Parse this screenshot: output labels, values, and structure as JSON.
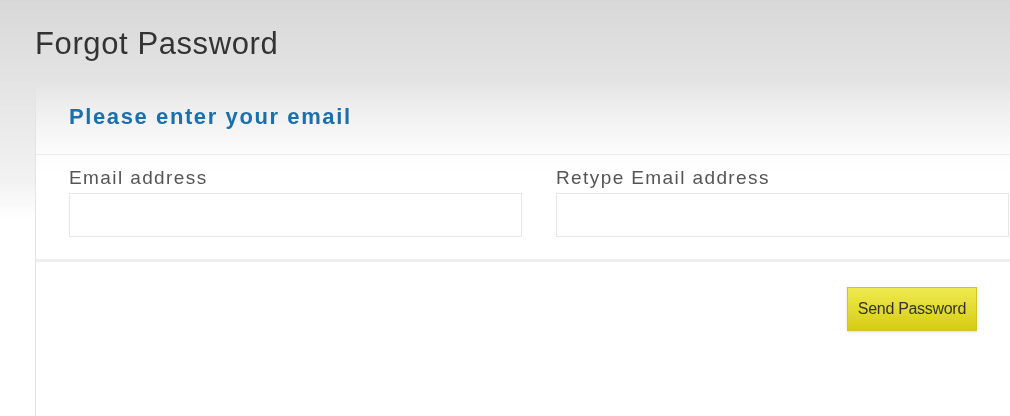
{
  "page_title": "Forgot Password",
  "form": {
    "heading": "Please enter your email",
    "fields": [
      {
        "label": "Email address"
      },
      {
        "label": "Retype Email address"
      }
    ],
    "submit_button": "Send Password"
  }
}
